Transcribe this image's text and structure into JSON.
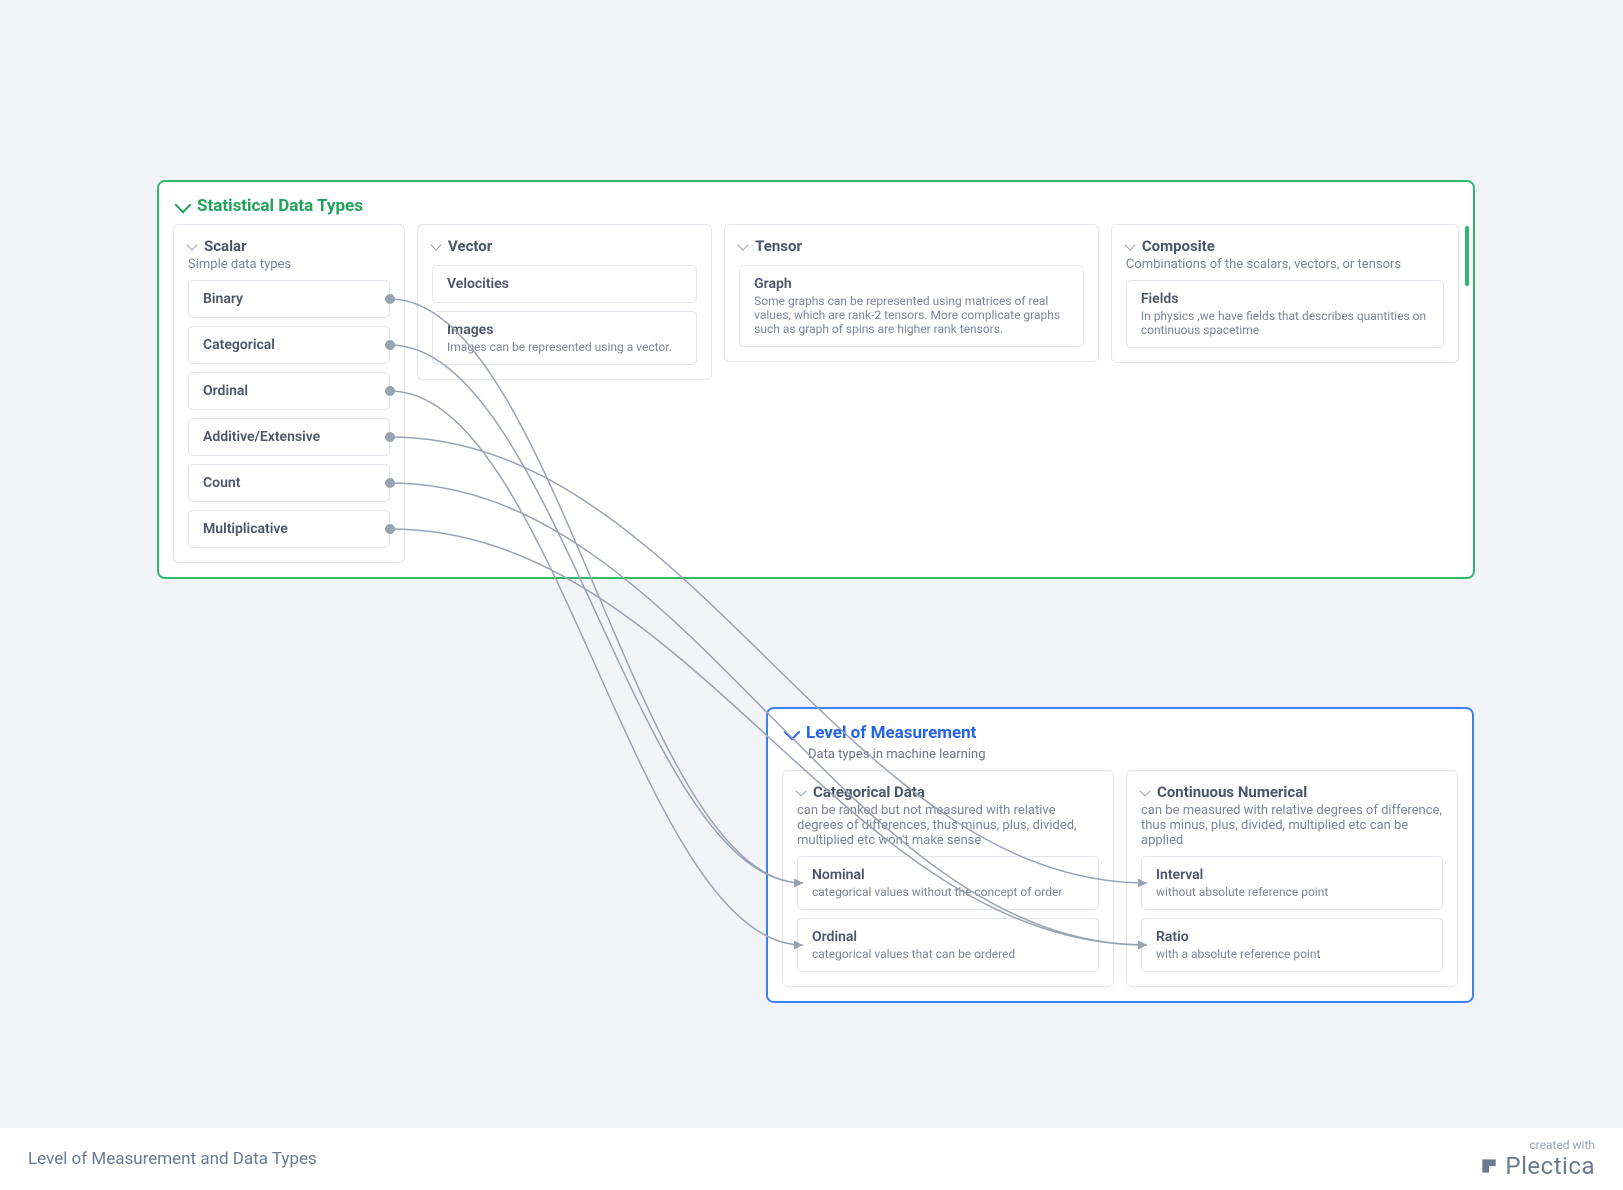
{
  "footer": {
    "docTitle": "Level of Measurement and Data Types",
    "createdWith": "created with",
    "brand": "Plectica"
  },
  "stat": {
    "title": "Statistical Data Types",
    "scalar": {
      "title": "Scalar",
      "subtitle": "Simple data types",
      "items": [
        "Binary",
        "Categorical",
        "Ordinal",
        "Additive/Extensive",
        "Count",
        "Multiplicative"
      ]
    },
    "vector": {
      "title": "Vector",
      "items": [
        {
          "title": "Velocities",
          "sub": ""
        },
        {
          "title": "Images",
          "sub": "Images can be represented using a vector."
        }
      ]
    },
    "tensor": {
      "title": "Tensor",
      "items": [
        {
          "title": "Graph",
          "sub": "Some graphs can be represented using matrices of real values, which are rank-2 tensors. More complicate graphs such as graph of spins are higher rank tensors."
        }
      ]
    },
    "composite": {
      "title": "Composite",
      "subtitle": "Combinations of the scalars, vectors, or tensors",
      "items": [
        {
          "title": "Fields",
          "sub": "In physics ,we have fields that describes quantities on continuous spacetime"
        }
      ]
    }
  },
  "lom": {
    "title": "Level of Measurement",
    "subtitle": "Data types in machine learning",
    "categorical": {
      "title": "Categorical Data",
      "subtitle": "can be ranked but not measured with relative degrees of differences, thus minus, plus, divided, multiplied etc won't make sense",
      "items": [
        {
          "title": "Nominal",
          "sub": "categorical values without the concept of order"
        },
        {
          "title": "Ordinal",
          "sub": "categorical values that can be ordered"
        }
      ]
    },
    "continuous": {
      "title": "Continuous Numerical",
      "subtitle": "can be measured with relative degrees of difference, thus minus, plus, divided, multiplied etc can be applied",
      "items": [
        {
          "title": "Interval",
          "sub": "without absolute reference point"
        },
        {
          "title": "Ratio",
          "sub": "with a absolute reference point"
        }
      ]
    }
  },
  "connections": [
    {
      "from": "scalar-binary",
      "to": "lom-nominal"
    },
    {
      "from": "scalar-categorical",
      "to": "lom-nominal"
    },
    {
      "from": "scalar-ordinal",
      "to": "lom-ordinal"
    },
    {
      "from": "scalar-additive",
      "to": "lom-interval"
    },
    {
      "from": "scalar-count",
      "to": "lom-ratio"
    },
    {
      "from": "scalar-multiplicative",
      "to": "lom-ratio"
    }
  ]
}
